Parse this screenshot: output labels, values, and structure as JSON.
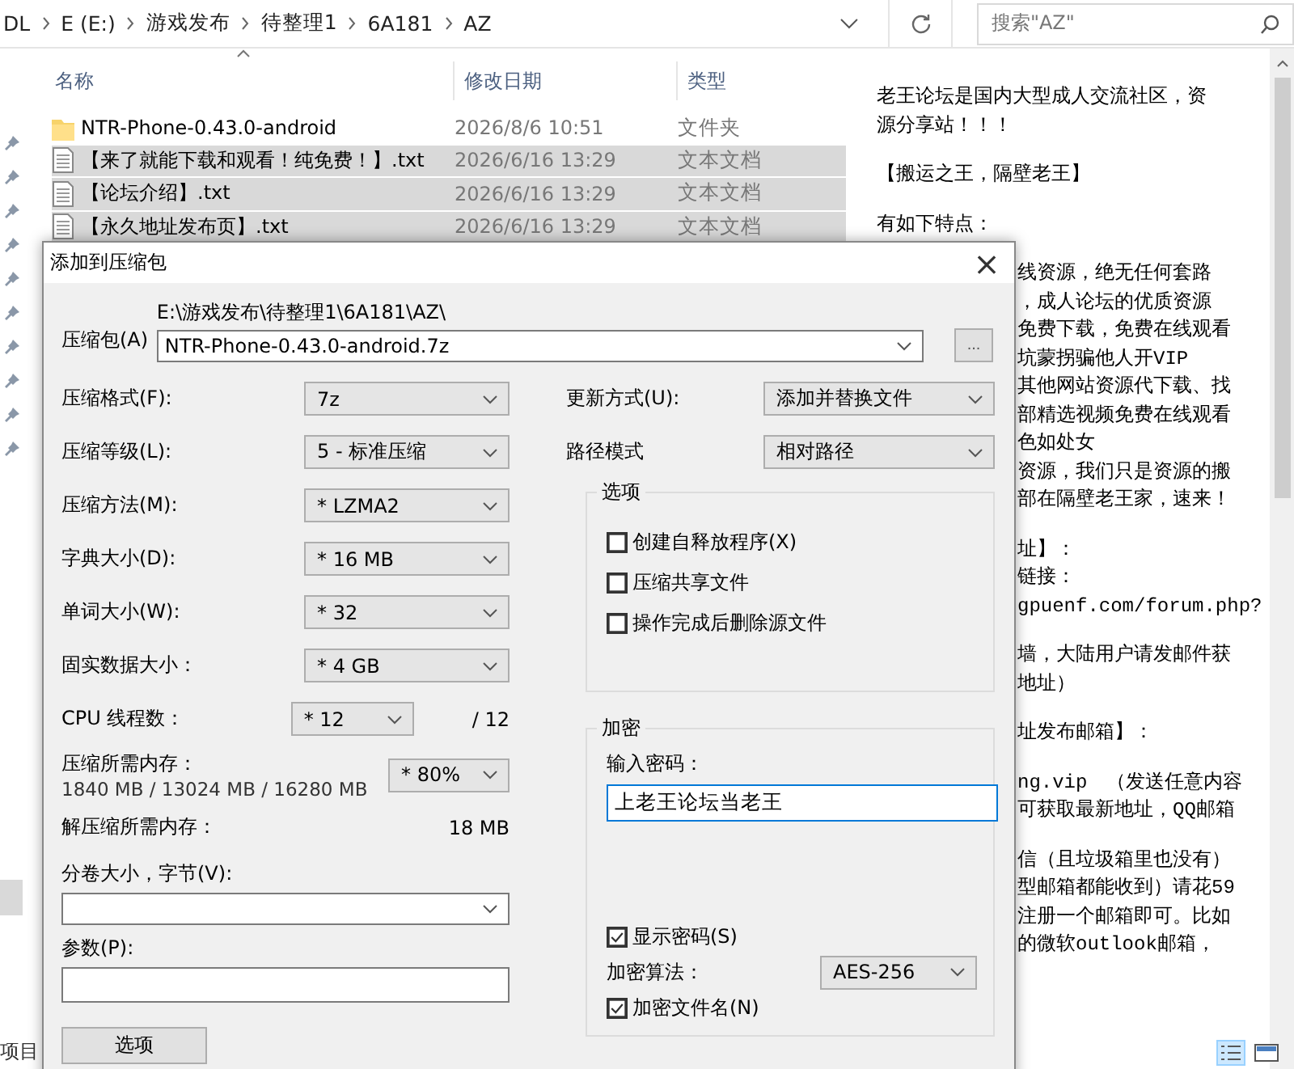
{
  "explorer": {
    "breadcrumb": [
      "DL",
      "E (E:)",
      "游戏发布",
      "待整理1",
      "6A181",
      "AZ"
    ],
    "search": {
      "placeholder": "搜索\"AZ\""
    },
    "columns": [
      {
        "label": "名称"
      },
      {
        "label": "修改日期"
      },
      {
        "label": "类型"
      }
    ],
    "files": [
      {
        "kind": "folder",
        "name": "NTR-Phone-0.43.0-android",
        "date": "2026/8/6 10:51",
        "type": "文件夹",
        "selected": false
      },
      {
        "kind": "text",
        "name": "【来了就能下载和观看！纯免费！】.txt",
        "date": "2026/6/16 13:29",
        "type": "文本文档",
        "selected": true
      },
      {
        "kind": "text",
        "name": "【论坛介绍】.txt",
        "date": "2026/6/16 13:29",
        "type": "文本文档",
        "selected": true
      },
      {
        "kind": "text",
        "name": "【永久地址发布页】.txt",
        "date": "2026/6/16 13:29",
        "type": "文本文档",
        "selected": true
      }
    ],
    "status": "项目"
  },
  "preview": {
    "paragraphs": [
      {
        "kind": "open",
        "lines": [
          "老王论坛是国内大型成人交流社区，资",
          "源分享站！！！"
        ]
      },
      {
        "kind": "open",
        "lines": [
          "【搬运之王，隔壁老王】"
        ]
      },
      {
        "kind": "open",
        "lines": [
          "有如下特点："
        ]
      },
      {
        "kind": "covered",
        "lines": [
          "线资源，绝无任何套路",
          "，成人论坛的优质资源",
          "免费下载，免费在线观看",
          "坑蒙拐骗他人开VIP",
          "其他网站资源代下载、找",
          "部精选视频免费在线观看",
          "色如处女",
          "资源，我们只是资源的搬",
          "部在隔壁老王家，速来！"
        ]
      },
      {
        "kind": "covered",
        "lines": [
          "址】：",
          "链接：",
          "gpuenf.com/forum.php?"
        ]
      },
      {
        "kind": "covered",
        "lines": [
          "墙，大陆用户请发邮件获",
          "地址）"
        ]
      },
      {
        "kind": "covered",
        "lines": [
          "址发布邮箱】："
        ]
      },
      {
        "kind": "covered",
        "lines": [
          "ng.vip　（发送任意内容",
          "可获取最新地址，QQ邮箱"
        ]
      },
      {
        "kind": "covered",
        "lines": [
          "信（且垃圾箱里也没有）",
          "型邮箱都能收到）请花59",
          "注册一个邮箱即可。比如",
          "的微软outlook邮箱，"
        ]
      }
    ]
  },
  "dialog": {
    "title": "添加到压缩包",
    "close": "×",
    "archive": {
      "label": "压缩包(A)",
      "path": "E:\\游戏发布\\待整理1\\6A181\\AZ\\",
      "name": "NTR-Phone-0.43.0-android.7z",
      "browse": "..."
    },
    "left": [
      {
        "kind": "select",
        "label": "压缩格式(F):",
        "value": "7z"
      },
      {
        "kind": "select",
        "label": "压缩等级(L):",
        "value": "5 - 标准压缩"
      },
      {
        "kind": "select",
        "label": "压缩方法(M):",
        "value": "* LZMA2"
      },
      {
        "kind": "select",
        "label": "字典大小(D):",
        "value": "* 16 MB"
      },
      {
        "kind": "select",
        "label": "单词大小(W):",
        "value": "* 32"
      },
      {
        "kind": "select",
        "label": "固实数据大小：",
        "value": "* 4 GB"
      },
      {
        "kind": "threads",
        "label": "CPU 线程数：",
        "value": "* 12",
        "suffix": "/ 12"
      },
      {
        "kind": "memory",
        "label": "压缩所需内存：",
        "detail": "1840 MB / 13024 MB / 16280 MB",
        "value": "* 80%"
      },
      {
        "kind": "info",
        "label": "解压缩所需内存：",
        "value": "18 MB"
      },
      {
        "kind": "combo",
        "label": "分卷大小，字节(V):"
      },
      {
        "kind": "field",
        "label": "参数(P):"
      }
    ],
    "update": {
      "label": "更新方式(U):",
      "value": "添加并替换文件"
    },
    "path_mode": {
      "label": "路径模式",
      "value": "相对路径"
    },
    "options": {
      "title": "选项",
      "items": [
        {
          "label": "创建自释放程序(X)",
          "checked": false
        },
        {
          "label": "压缩共享文件",
          "checked": false
        },
        {
          "label": "操作完成后删除源文件",
          "checked": false
        }
      ]
    },
    "encryption": {
      "title": "加密",
      "password_label": "输入密码：",
      "password": "上老王论坛当老王",
      "show_password": {
        "label": "显示密码(S)",
        "checked": true
      },
      "method": {
        "label": "加密算法：",
        "value": "AES-256"
      },
      "encrypt_names": {
        "label": "加密文件名(N)",
        "checked": true
      }
    },
    "options_button": "选项"
  }
}
